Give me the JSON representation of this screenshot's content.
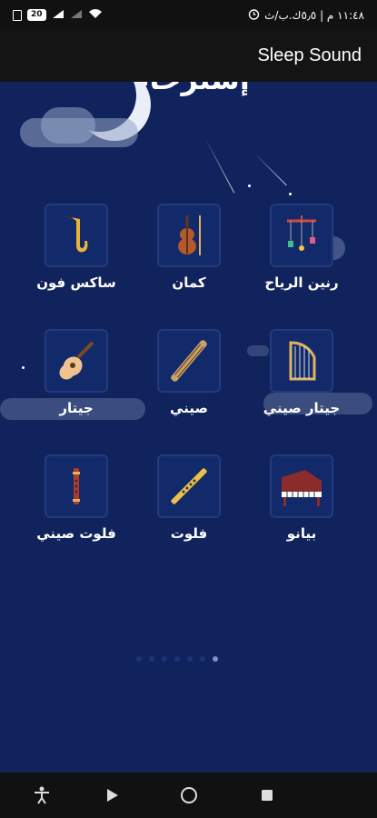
{
  "status_bar": {
    "time": "١١:٤٨ م | ٥٫٥ك.ب/ث",
    "battery": "20"
  },
  "app": {
    "title": "Sleep Sound"
  },
  "welcome": "إسترخاء",
  "items": [
    {
      "label": "رنين الرياح",
      "icon": "wind-chime-icon"
    },
    {
      "label": "كمان",
      "icon": "violin-icon"
    },
    {
      "label": "ساكس فون",
      "icon": "saxophone-icon"
    },
    {
      "label": "جيتار صيني",
      "icon": "harp-icon"
    },
    {
      "label": "صيني",
      "icon": "chinese-zither-icon"
    },
    {
      "label": "جيتار",
      "icon": "guitar-icon"
    },
    {
      "label": "بيانو",
      "icon": "piano-icon"
    },
    {
      "label": "فلوت",
      "icon": "flute-icon"
    },
    {
      "label": "فلوت صيني",
      "icon": "chinese-flute-icon"
    }
  ],
  "pager": {
    "count": 7,
    "active": 6
  },
  "colors": {
    "background": "#10235c",
    "appbar": "#141414",
    "tile": "#122a6a"
  }
}
